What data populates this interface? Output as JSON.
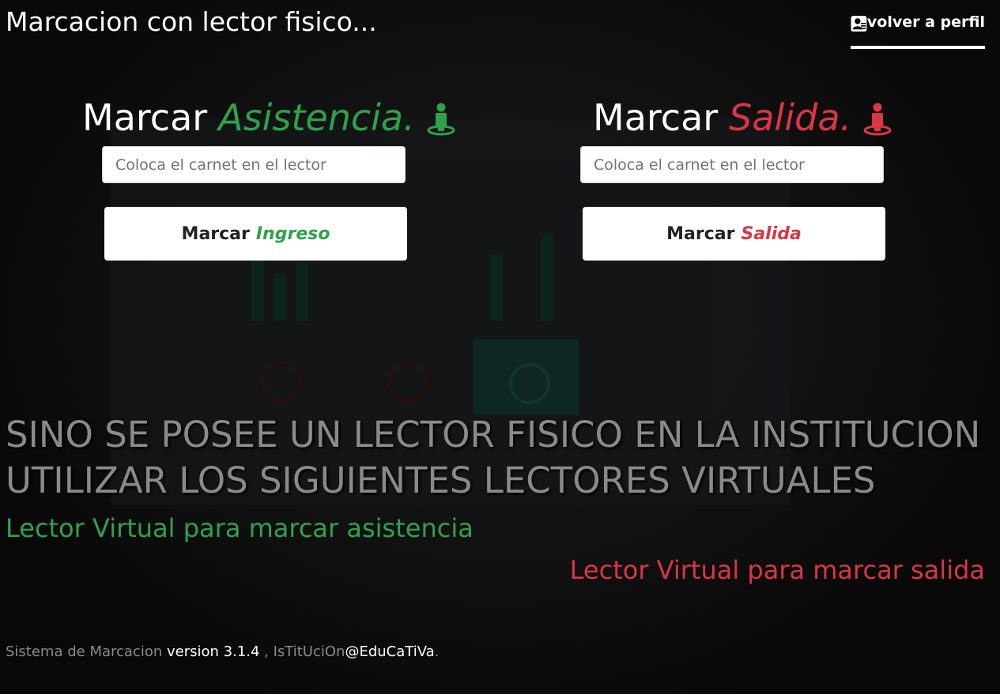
{
  "header": {
    "title": "Marcacion con lector fisico...",
    "profile_link_label": "volver a perfil",
    "profile_icon": "user-card-icon"
  },
  "entry": {
    "heading_prefix": "Marcar",
    "heading_accent": "Asistencia.",
    "heading_icon": "person-location-icon",
    "input_placeholder": "Coloca el carnet en el lector",
    "input_value": "",
    "button_prefix": "Marcar",
    "button_accent": "Ingreso",
    "accent_color": "#2ea24a"
  },
  "exit": {
    "heading_prefix": "Marcar",
    "heading_accent": "Salida.",
    "heading_icon": "person-location-icon",
    "input_placeholder": "Coloca el carnet en el lector",
    "input_value": "",
    "button_prefix": "Marcar",
    "button_accent": "Salida",
    "accent_color": "#dc3545"
  },
  "notice": {
    "line1": "SINO SE POSEE UN LECTOR FISICO EN LA INSTITUCION",
    "line2": "UTILIZAR LOS SIGUIENTES LECTORES VIRTUALES"
  },
  "virtual_links": {
    "attendance": "Lector Virtual para marcar asistencia",
    "exit": "Lector Virtual para marcar salida"
  },
  "footer": {
    "system_label": "Sistema de Marcacion",
    "version": "version 3.1.4",
    "separator": " , ",
    "institution": "IsTitUciOn",
    "brand": "@EduCaTiVa",
    "end": "."
  }
}
